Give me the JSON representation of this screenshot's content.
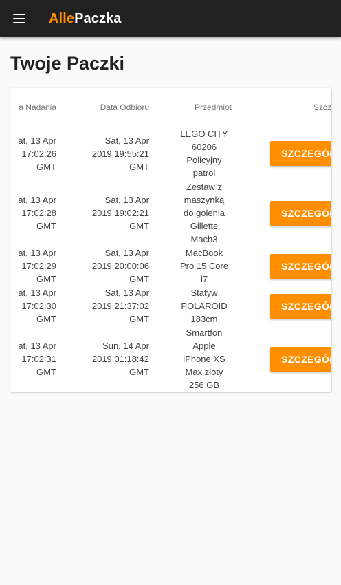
{
  "appbar": {
    "brand_part1": "Alle",
    "brand_part2": "Paczka",
    "brand_color": "#ff8f00",
    "bar_color": "#212121"
  },
  "page": {
    "title": "Twoje Paczki"
  },
  "table": {
    "headers": [
      "Data Nadania",
      "Data Odbioru",
      "Przedmiot",
      "Szczegóły"
    ],
    "header_visible": [
      "a Nadania",
      "Data Odbioru",
      "Przedmiot",
      "Szczeg"
    ],
    "rows": [
      {
        "sent": [
          "at, 13 Apr",
          "17:02:26",
          "GMT"
        ],
        "received": [
          "Sat, 13 Apr",
          "2019 19:55:21",
          "GMT"
        ],
        "item": [
          "LEGO CITY",
          "60206",
          "Policyjny",
          "patrol"
        ],
        "button": "SZCZEGÓŁY"
      },
      {
        "sent": [
          "at, 13 Apr",
          "17:02:28",
          "GMT"
        ],
        "received": [
          "Sat, 13 Apr",
          "2019 19:02:21",
          "GMT"
        ],
        "item": [
          "Zestaw z",
          "maszynką",
          "do golenia",
          "Gillette",
          "Mach3"
        ],
        "button": "SZCZEGÓŁY"
      },
      {
        "sent": [
          "at, 13 Apr",
          "17:02:29",
          "GMT"
        ],
        "received": [
          "Sat, 13 Apr",
          "2019 20:00:06",
          "GMT"
        ],
        "item": [
          "MacBook",
          "Pro 15 Core",
          "i7"
        ],
        "button": "SZCZEGÓŁY"
      },
      {
        "sent": [
          "at, 13 Apr",
          "17:02:30",
          "GMT"
        ],
        "received": [
          "Sat, 13 Apr",
          "2019 21:37:02",
          "GMT"
        ],
        "item": [
          "Statyw",
          "POLAROID",
          "183cm"
        ],
        "button": "SZCZEGÓŁY"
      },
      {
        "sent": [
          "at, 13 Apr",
          "17:02:31",
          "GMT"
        ],
        "received": [
          "Sun, 14 Apr",
          "2019 01:18:42",
          "GMT"
        ],
        "item": [
          "Smartfon",
          "Apple",
          "iPhone XS",
          "Max złoty",
          "256 GB"
        ],
        "button": "SZCZEGÓŁY"
      }
    ]
  }
}
